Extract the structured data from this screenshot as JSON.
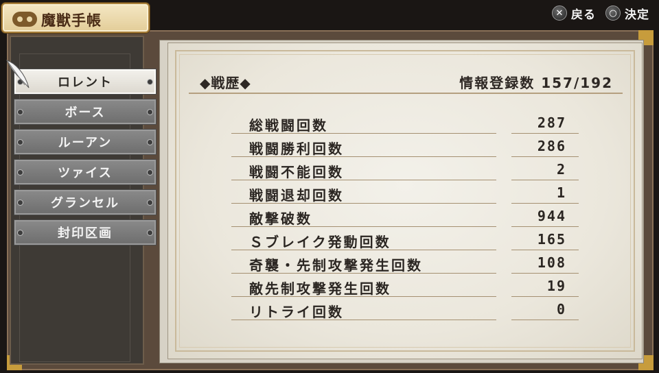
{
  "header": {
    "title": "魔獣手帳"
  },
  "hints": [
    {
      "icon": "cross-button-icon",
      "symbol": "✕",
      "label": "戻る"
    },
    {
      "icon": "circle-button-icon",
      "symbol": "○",
      "label": "決定"
    }
  ],
  "sidebar": {
    "tabs": [
      {
        "label": "ロレント",
        "active": true
      },
      {
        "label": "ボース",
        "active": false
      },
      {
        "label": "ルーアン",
        "active": false
      },
      {
        "label": "ツァイス",
        "active": false
      },
      {
        "label": "グランセル",
        "active": false
      },
      {
        "label": "封印区画",
        "active": false
      }
    ]
  },
  "main": {
    "section_title": "◆戦歴◆",
    "info_count": "情報登録数 157/192",
    "stats": [
      {
        "label": "総戦闘回数",
        "value": "287"
      },
      {
        "label": "戦闘勝利回数",
        "value": "286"
      },
      {
        "label": "戦闘不能回数",
        "value": "2"
      },
      {
        "label": "戦闘退却回数",
        "value": "1"
      },
      {
        "label": "敵撃破数",
        "value": "944"
      },
      {
        "label": "Ｓブレイク発動回数",
        "value": "165"
      },
      {
        "label": "奇襲・先制攻撃発生回数",
        "value": "108"
      },
      {
        "label": "敵先制攻撃発生回数",
        "value": "19"
      },
      {
        "label": "リトライ回数",
        "value": "0"
      }
    ]
  },
  "colors": {
    "frame": "#5b4a3c",
    "page": "#efece3",
    "tab_active": "#e9e6df",
    "tab_inactive": "#7a7a7a",
    "gold": "#c79c3c"
  }
}
